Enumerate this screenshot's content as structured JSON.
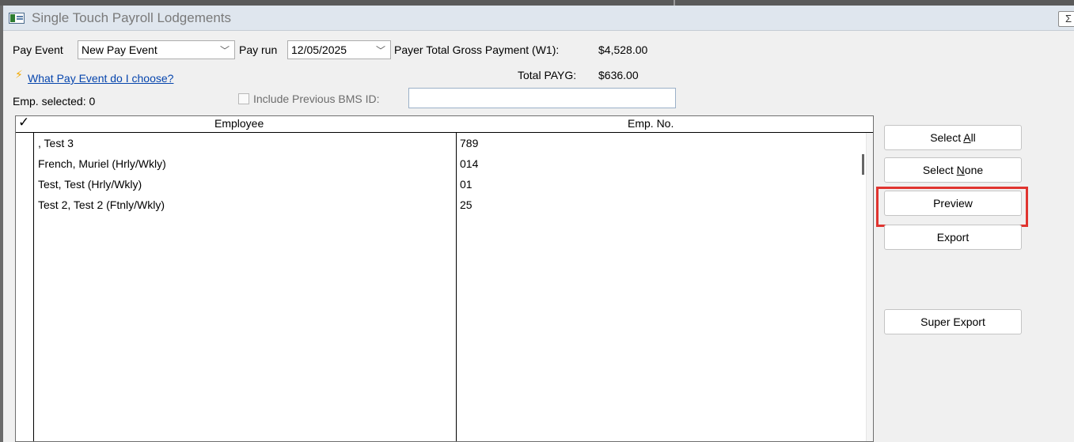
{
  "window": {
    "title": "Single Touch Payroll Lodgements",
    "close_label": "Σ"
  },
  "pay_event": {
    "label": "Pay Event",
    "value": "New Pay Event"
  },
  "pay_run": {
    "label": "Pay run",
    "value": "12/05/2025"
  },
  "payer_total": {
    "label": "Payer Total Gross Payment (W1):",
    "value": "$4,528.00"
  },
  "help_link": "What Pay Event do I choose?",
  "total_payg": {
    "label": "Total PAYG:",
    "value": "$636.00"
  },
  "emp_selected": "Emp. selected: 0",
  "include_prev": {
    "label": "Include Previous BMS ID:",
    "value": ""
  },
  "grid": {
    "check_header": "✓",
    "col_employee": "Employee",
    "col_emp_no": "Emp. No.",
    "rows": [
      {
        "employee": ", Test 3",
        "emp_no": "789"
      },
      {
        "employee": "French, Muriel (Hrly/Wkly)",
        "emp_no": "014"
      },
      {
        "employee": "Test, Test (Hrly/Wkly)",
        "emp_no": "01"
      },
      {
        "employee": "Test 2, Test 2 (Ftnly/Wkly)",
        "emp_no": "25"
      }
    ]
  },
  "buttons": {
    "select_all": {
      "pre": "Select ",
      "mnemonic": "A",
      "post": "ll"
    },
    "select_none": {
      "pre": "Select ",
      "mnemonic": "N",
      "post": "one"
    },
    "preview": "Preview",
    "export": "Export",
    "super_export": "Super Export"
  },
  "colors": {
    "highlight": "#e0342f",
    "link": "#0645ad",
    "bolt": "#f2a900"
  }
}
